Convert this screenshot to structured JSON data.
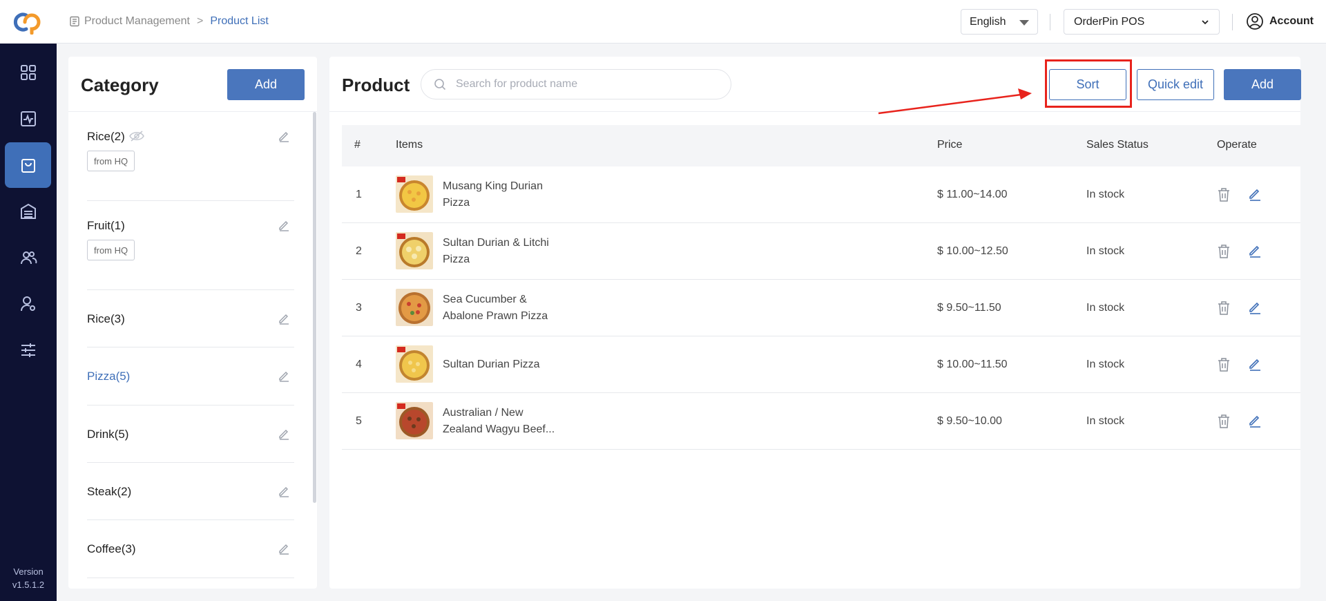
{
  "app": {
    "version_label": "Version",
    "version": "v1.5.1.2",
    "accent_color": "#3f6fb8",
    "sidebar_color": "#0e1233"
  },
  "sidebar": {
    "items": [
      {
        "icon": "dashboard-grid-icon"
      },
      {
        "icon": "activity-chart-icon"
      },
      {
        "icon": "shopping-bag-icon",
        "active": true
      },
      {
        "icon": "inventory-icon"
      },
      {
        "icon": "customers-icon"
      },
      {
        "icon": "user-settings-icon"
      },
      {
        "icon": "sliders-icon"
      }
    ]
  },
  "header": {
    "breadcrumb": {
      "parent": "Product Management",
      "separator": ">",
      "current": "Product List"
    },
    "language": "English",
    "store": "OrderPin POS",
    "account_label": "Account"
  },
  "category": {
    "title": "Category",
    "add_label": "Add",
    "items": [
      {
        "name": "Rice(2)",
        "hidden": true,
        "badge": "from HQ"
      },
      {
        "name": "Fruit(1)",
        "badge": "from HQ"
      },
      {
        "name": "Rice(3)"
      },
      {
        "name": "Pizza(5)",
        "active": true
      },
      {
        "name": "Drink(5)"
      },
      {
        "name": "Steak(2)"
      },
      {
        "name": "Coffee(3)"
      }
    ]
  },
  "product": {
    "title": "Product",
    "search_placeholder": "Search for product name",
    "sort_label": "Sort",
    "quick_edit_label": "Quick edit",
    "add_label": "Add",
    "columns": {
      "index": "#",
      "items": "Items",
      "price": "Price",
      "status": "Sales Status",
      "operate": "Operate"
    },
    "rows": [
      {
        "index": "1",
        "name_line1": "Musang King Durian",
        "name_line2": "Pizza",
        "price": "$ 11.00~14.00",
        "status": "In stock"
      },
      {
        "index": "2",
        "name_line1": "Sultan Durian & Litchi",
        "name_line2": "Pizza",
        "price": "$ 10.00~12.50",
        "status": "In stock"
      },
      {
        "index": "3",
        "name_line1": "Sea Cucumber &",
        "name_line2": "Abalone Prawn Pizza",
        "price": "$ 9.50~11.50",
        "status": "In stock"
      },
      {
        "index": "4",
        "name_line1": "Sultan Durian Pizza",
        "name_line2": "",
        "price": "$ 10.00~11.50",
        "status": "In stock"
      },
      {
        "index": "5",
        "name_line1": "Australian / New",
        "name_line2": "Zealand Wagyu Beef...",
        "price": "$ 9.50~10.00",
        "status": "In stock"
      }
    ]
  },
  "annotation": {
    "highlight_color": "#e8231c"
  }
}
